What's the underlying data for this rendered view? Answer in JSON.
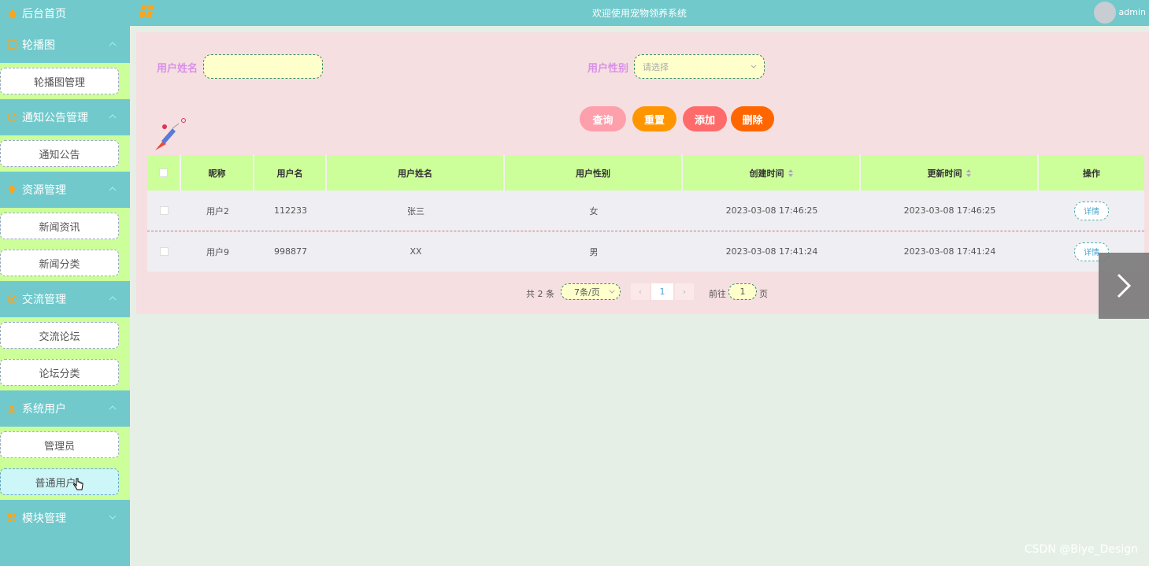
{
  "header": {
    "title": "欢迎使用宠物领养系统",
    "user": "admin"
  },
  "sidebar": {
    "home": "后台首页",
    "groups": [
      {
        "label": "轮播图",
        "icon": "image-icon",
        "items": [
          "轮播图管理"
        ]
      },
      {
        "label": "通知公告管理",
        "icon": "clock-icon",
        "items": [
          "通知公告"
        ]
      },
      {
        "label": "资源管理",
        "icon": "location-icon",
        "items": [
          "新闻资讯",
          "新闻分类"
        ]
      },
      {
        "label": "交流管理",
        "icon": "circle-icon",
        "items": [
          "交流论坛",
          "论坛分类"
        ]
      },
      {
        "label": "系统用户",
        "icon": "user-icon",
        "items": [
          "管理员",
          "普通用户"
        ]
      },
      {
        "label": "模块管理",
        "icon": "grid-icon",
        "items": []
      }
    ],
    "active_item": "普通用户"
  },
  "search": {
    "name_label": "用户姓名",
    "name_value": "",
    "gender_label": "用户性别",
    "gender_placeholder": "请选择"
  },
  "actions": {
    "query": "查询",
    "reset": "重置",
    "add": "添加",
    "delete": "删除"
  },
  "colors": {
    "query": "#fe9fac",
    "reset": "#ff9600",
    "add": "#ff6b6b",
    "delete": "#ff6600",
    "accent": "#71c9cc"
  },
  "table": {
    "headers": [
      "昵称",
      "用户名",
      "用户姓名",
      "用户性别",
      "创建时间",
      "更新时间",
      "操作"
    ],
    "rows": [
      {
        "nickname": "用户2",
        "username": "112233",
        "realname": "张三",
        "gender": "女",
        "created": "2023-03-08 17:46:25",
        "updated": "2023-03-08 17:46:25",
        "action": "详情"
      },
      {
        "nickname": "用户9",
        "username": "998877",
        "realname": "XX",
        "gender": "男",
        "created": "2023-03-08 17:41:24",
        "updated": "2023-03-08 17:41:24",
        "action": "详情"
      }
    ]
  },
  "pagination": {
    "total": "共 2 条",
    "page_size": "7条/页",
    "current": "1",
    "goto_prefix": "前往",
    "goto_value": "1",
    "goto_suffix": "页"
  },
  "watermark": "CSDN @Biye_Design"
}
